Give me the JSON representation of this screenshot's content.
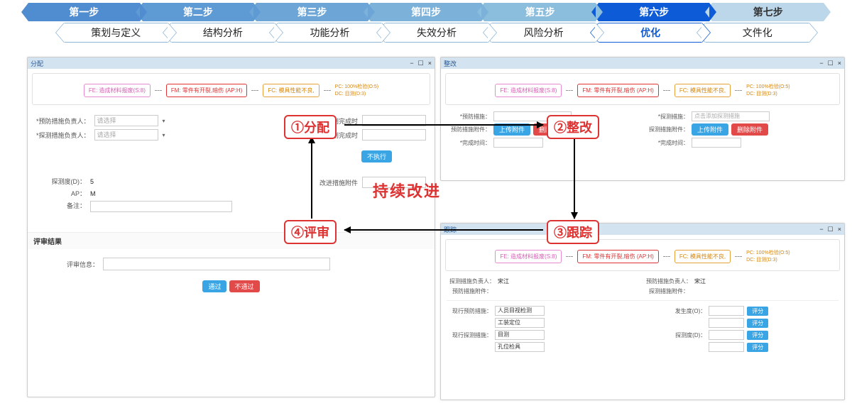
{
  "steps": {
    "top": [
      "第一步",
      "第二步",
      "第三步",
      "第四步",
      "第五步",
      "第六步",
      "第七步"
    ],
    "sub": [
      "策划与定义",
      "结构分析",
      "功能分析",
      "失效分析",
      "风险分析",
      "优化",
      "文件化"
    ],
    "activeIndex": 5
  },
  "stages": {
    "s1": "①分配",
    "s2": "②整改",
    "s3": "③跟踪",
    "s4": "④评审",
    "center": "持续改进"
  },
  "chain": {
    "fe": "FE: 造成材料报废(S:8)",
    "fm": "FM: 零件有开裂,暗伤 (AP:H)",
    "fc": "FC: 模具性能不良,",
    "pc": "PC: 100%检验(O:5)",
    "dc": "DC: 目测(D:3)"
  },
  "panelA": {
    "title": "分配",
    "prevOwner": "*预防措施负责人：",
    "detOwner": "*探测措施负责人：",
    "placeholder": "请选择",
    "planDate1": "*计划完成时",
    "planDate2": "*计划完成时",
    "noexec": "不执行",
    "improveAttach": "改进措施附件",
    "detectD": "探测度(D)：",
    "detectDVal": "5",
    "ap": "AP：",
    "apVal": "M",
    "remark": "备注：",
    "reviewResult": "评审结果",
    "reviewInfo": "评审信息：",
    "pass": "通过",
    "fail": "不通过"
  },
  "panelB": {
    "title": "整改",
    "prevMeasure": "*预防措施：",
    "prevPlaceholder": "",
    "prevAttach": "预防措施附件：",
    "detMeasure": "*探测措施：",
    "detPlaceholder": "点击添加探测措施",
    "detAttach": "探测措施附件：",
    "upload": "上传附件",
    "delete": "删除附件",
    "doneTime": "*完成时间："
  },
  "panelC": {
    "title": "跟踪",
    "detOwnerLabel": "探测措施负责人：",
    "detOwnerVal": "宋江",
    "prevOwnerLabel": "预防措施负责人：",
    "prevOwnerVal": "宋江",
    "prevAttach": "预防措施附件：",
    "detAttach": "探测措施附件：",
    "curPrev": "现行预防措施：",
    "curPrevVals": [
      "人员目视检测",
      "工装定位"
    ],
    "curDet": "现行探测措施：",
    "curDetVals": [
      "目测",
      "孔位检具"
    ],
    "occO": "发生度(O)：",
    "detD": "探测度(D)：",
    "eval": "评分"
  }
}
